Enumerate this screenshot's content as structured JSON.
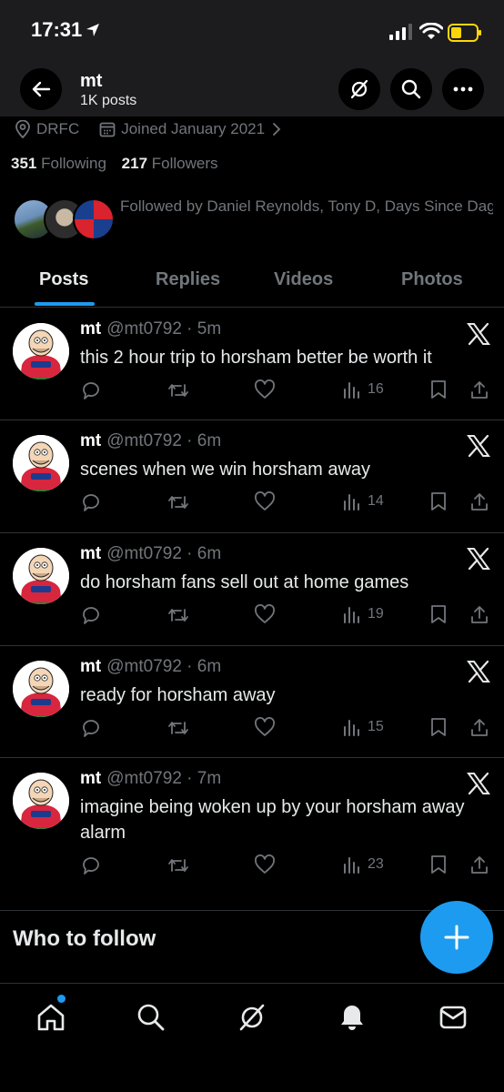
{
  "status_bar": {
    "time": "17:31"
  },
  "header": {
    "title": "mt",
    "subtitle": "1K posts"
  },
  "profile": {
    "location": "DRFC",
    "joined": "Joined January 2021",
    "following_count": "351",
    "following_label": "Following",
    "followers_count": "217",
    "followers_label": "Followers",
    "followed_by": "Followed by Daniel Reynolds, Tony D, Days Since Dagenham and Redbridge won a troph..."
  },
  "tabs": [
    {
      "label": "Posts",
      "active": true
    },
    {
      "label": "Replies",
      "active": false
    },
    {
      "label": "Videos",
      "active": false
    },
    {
      "label": "Photos",
      "active": false
    }
  ],
  "posts": [
    {
      "name": "mt",
      "handle": "@mt0792",
      "time": "5m",
      "text": "this 2 hour trip to horsham better be worth it",
      "views": "16"
    },
    {
      "name": "mt",
      "handle": "@mt0792",
      "time": "6m",
      "text": "scenes when we win horsham away",
      "views": "14"
    },
    {
      "name": "mt",
      "handle": "@mt0792",
      "time": "6m",
      "text": "do horsham fans sell out at home games",
      "views": "19"
    },
    {
      "name": "mt",
      "handle": "@mt0792",
      "time": "6m",
      "text": "ready for horsham away",
      "views": "15"
    },
    {
      "name": "mt",
      "handle": "@mt0792",
      "time": "7m",
      "text": "imagine being woken up by your horsham away alarm",
      "views": "23"
    }
  ],
  "who_to_follow": "Who to follow",
  "colors": {
    "accent": "#1d9bf0",
    "muted": "#71767b",
    "text": "#e7e9ea",
    "divider": "#2f3336",
    "header_bg": "#1c1c1e",
    "battery": "#ffd60a"
  },
  "icons": {
    "nav": [
      "home-icon",
      "search-icon",
      "grok-icon",
      "notifications-icon",
      "messages-icon"
    ],
    "post_actions": [
      "reply-icon",
      "repost-icon",
      "like-icon",
      "views-icon",
      "bookmark-icon",
      "share-icon"
    ]
  }
}
